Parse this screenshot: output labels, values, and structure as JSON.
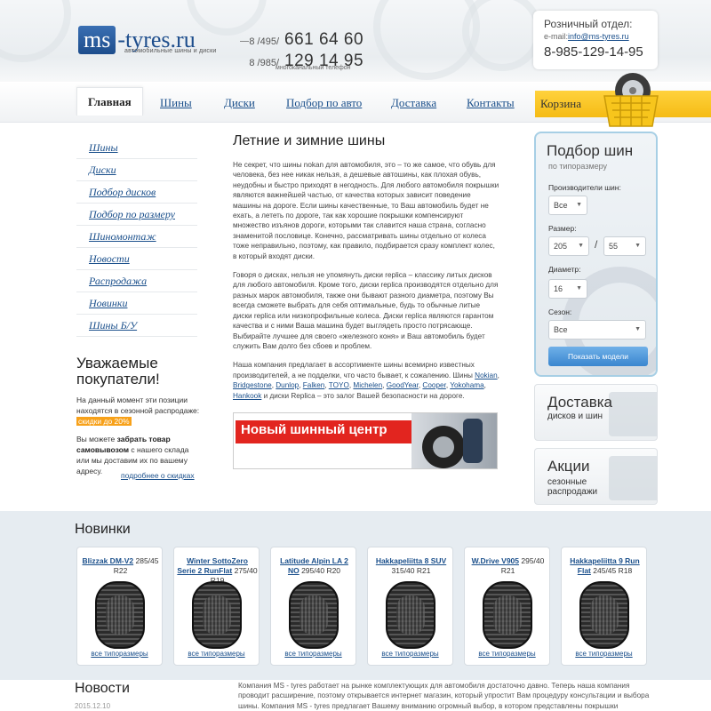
{
  "header": {
    "logo_main": "ms",
    "logo_rest": "-tyres.ru",
    "logo_sub": "автомобильные шины и диски",
    "phones": [
      {
        "code": "8 /495/",
        "number": "661 64 60"
      },
      {
        "code": "8 /985/",
        "number": "129 14 95"
      }
    ],
    "phone_note": "многоканальный телефон",
    "retail_title": "Розничный отдел:",
    "retail_mail_label": "e-mail:",
    "retail_mail": "info@ms-tyres.ru",
    "retail_phone": "8-985-129-14-95"
  },
  "nav": {
    "items": [
      "Главная",
      "Шины",
      "Диски",
      "Подбор по авто",
      "Доставка",
      "Контакты"
    ],
    "cart": "Корзина"
  },
  "leftnav": {
    "items": [
      "Шины",
      "Диски",
      "Подбор дисков",
      "Подбор по размеру",
      "Шиномонтаж",
      "Новости",
      "Распродажа",
      "Новинки",
      "Шины Б/У"
    ]
  },
  "promo": {
    "title": "Уважаемые покупатели!",
    "text1": "На данный момент эти позиции находятся в сезонной распродаже:",
    "highlight": "скидки до 20%",
    "text2_pre": "Вы можете",
    "text2_bold": "забрать товар самовывозом",
    "text2_post": "с нашего склада или мы доставим их по вашему адресу.",
    "link": "подробнее о скидках"
  },
  "content": {
    "title": "Летние и зимние шины",
    "p1": "Не секрет, что шины nokan для автомобиля, это – то же самое, что обувь для человека, без нее никак нельзя, а дешевые автошины, как плохая обувь, неудобны и быстро приходят в негодность. Для любого автомобиля покрышки являются важнейшей частью, от качества которых зависит поведение машины на дороге. Если шины качественные, то Ваш автомобиль будет не ехать, а лететь по дороге, так как хорошие покрышки компенсируют множество изъянов дороги, которыми так славится наша страна, согласно знаменитой пословице. Конечно, рассматривать шины отдельно от колеса тоже неправильно, поэтому, как правило, подбирается сразу комплект колес, в который входят диски.",
    "p2": "Говоря о дисках, нельзя не упомянуть диски replica – классику литых дисков для любого автомобиля. Кроме того, диски replica производятся отдельно для разных марок автомобиля, также они бывают разного диаметра, поэтому Вы всегда сможете выбрать для себя оптимальные, будь то обычные литые диски replica или низкопрофильные колеса. Диски replica являются гарантом качества и с ними Ваша машина будет выглядеть просто потрясающе. Выбирайте лучшее для своего «железного коня» и Ваш автомобиль будет служить Вам долго без сбоев и проблем.",
    "p3_pre": "Наша компания предлагает в ассортименте шины всемирно известных производителей, а не подделки, что часто бывает, к сожалению. Шины",
    "brands": [
      "Nokian",
      "Bridgestone",
      "Dunlop",
      "Falken",
      "TOYO",
      "Michelen",
      "GoodYear",
      "Cooper",
      "Yokohama",
      "Hankook"
    ],
    "p3_post": "и диски Replica – это залог Вашей безопасности на дороге.",
    "banner": "Новый шинный центр"
  },
  "picker": {
    "title": "Подбор шин",
    "subtitle": "по типоразмеру",
    "maker_label": "Производители шин:",
    "maker_value": "Все",
    "size_label": "Размер:",
    "width_value": "205",
    "profile_value": "55",
    "slash": "/",
    "diameter_label": "Диаметр:",
    "diameter_value": "16",
    "season_label": "Сезон:",
    "season_value": "Все",
    "button": "Показать модели"
  },
  "delivery": {
    "big": "Доставка",
    "small": "дисков и шин"
  },
  "actions": {
    "big": "Акции",
    "small1": "сезонные",
    "small2": "распродажи"
  },
  "novelty": {
    "title": "Новинки",
    "link": "все типоразмеры",
    "items": [
      {
        "name": "Blizzak DM-V2",
        "size": "285/45 R22"
      },
      {
        "name": "Winter SottoZero Serie 2 RunFlat",
        "size": "275/40 R19"
      },
      {
        "name": "Latitude Alpin LA 2 NO",
        "size": "295/40 R20"
      },
      {
        "name": "Hakkapeliitta 8 SUV",
        "size": "315/40 R21"
      },
      {
        "name": "W.Drive V905",
        "size": "295/40 R21"
      },
      {
        "name": "Hakkapeliitta 9 Run Flat",
        "size": "245/45 R18"
      }
    ]
  },
  "news": {
    "title": "Новости",
    "date": "2015.12.10",
    "text": "Компания MS - tyres работает на рынке комплектующих для автомобиля достаточно давно. Теперь наша компания проводит расширение, поэтому открывается интернет магазин, который упростит Вам процедуру консультации и выбора шины. Компания MS - tyres предлагает Вашему вниманию огромный выбор, в котором представлены покрышки"
  },
  "colors": {
    "brand": "#1d4d8c",
    "accent": "#f5bb14",
    "link": "#1a4f8b",
    "sale": "#f7a11a",
    "banner_red": "#e2251f"
  }
}
